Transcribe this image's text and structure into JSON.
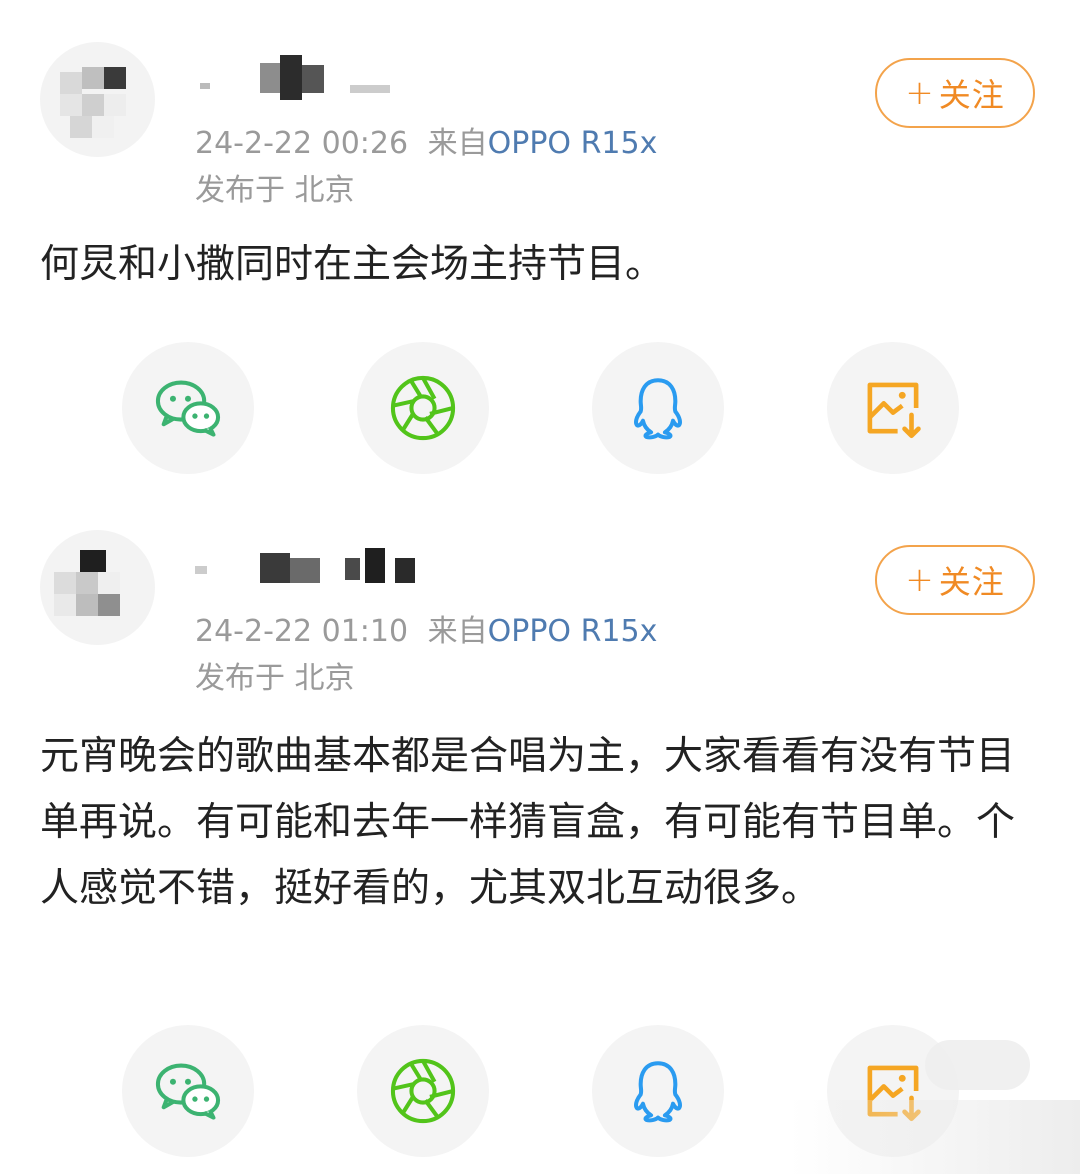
{
  "posts": [
    {
      "follow_label": "关注",
      "follow_plus": "+",
      "timestamp": "24-2-22 00:26",
      "source_prefix": "来自",
      "device": "OPPO R15x",
      "location": "发布于 北京",
      "content": "何炅和小撒同时在主会场主持节目。"
    },
    {
      "follow_label": "关注",
      "follow_plus": "+",
      "timestamp": "24-2-22 01:10",
      "source_prefix": "来自",
      "device": "OPPO R15x",
      "location": "发布于 北京",
      "content": "元宵晚会的歌曲基本都是合唱为主，大家看看有没有节目单再说。有可能和去年一样猜盲盒，有可能有节目单。个人感觉不错，挺好看的，尤其双北互动很多。"
    }
  ],
  "share_targets": [
    "wechat-icon",
    "moments-icon",
    "qq-icon",
    "save-image-icon"
  ],
  "colors": {
    "follow": "#f08a24",
    "device_link": "#4f7bb0",
    "wechat": "#3cb371",
    "moments": "#52c41a",
    "qq": "#2a9bf0",
    "save": "#f5a623"
  }
}
